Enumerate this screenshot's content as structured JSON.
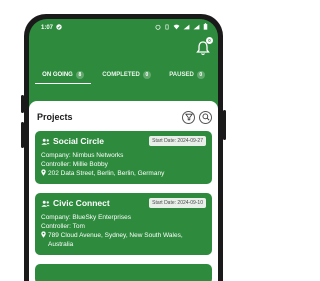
{
  "status": {
    "time": "1:07",
    "battery_icon": "battery-icon",
    "signal_icon": "signal-icon",
    "wifi_icon": "wifi-icon"
  },
  "appbar": {
    "notification_count": "0"
  },
  "tabs": [
    {
      "label": "ON GOING",
      "count": "8",
      "active": true
    },
    {
      "label": "COMPLETED",
      "count": "0",
      "active": false
    },
    {
      "label": "PAUSED",
      "count": "0",
      "active": false
    }
  ],
  "projects": {
    "title": "Projects",
    "cards": [
      {
        "name": "Social Circle",
        "start_date": "Start Date: 2024-09-27",
        "company": "Company: Nimbus Networks",
        "controller": "Controller: Millie Bobby",
        "address": "202 Data Street, Berlin, Berlin, Germany"
      },
      {
        "name": "Civic Connect",
        "start_date": "Start Date: 2024-09-10",
        "company": "Company: BlueSky Enterprises",
        "controller": "Controller: Tom",
        "address": "789 Cloud Avenue, Sydney, New South Wales, Australia"
      }
    ]
  },
  "colors": {
    "primary": "#2e8b3e",
    "card_bg": "#2e8b3e",
    "badge_bg": "#e8efe9"
  }
}
